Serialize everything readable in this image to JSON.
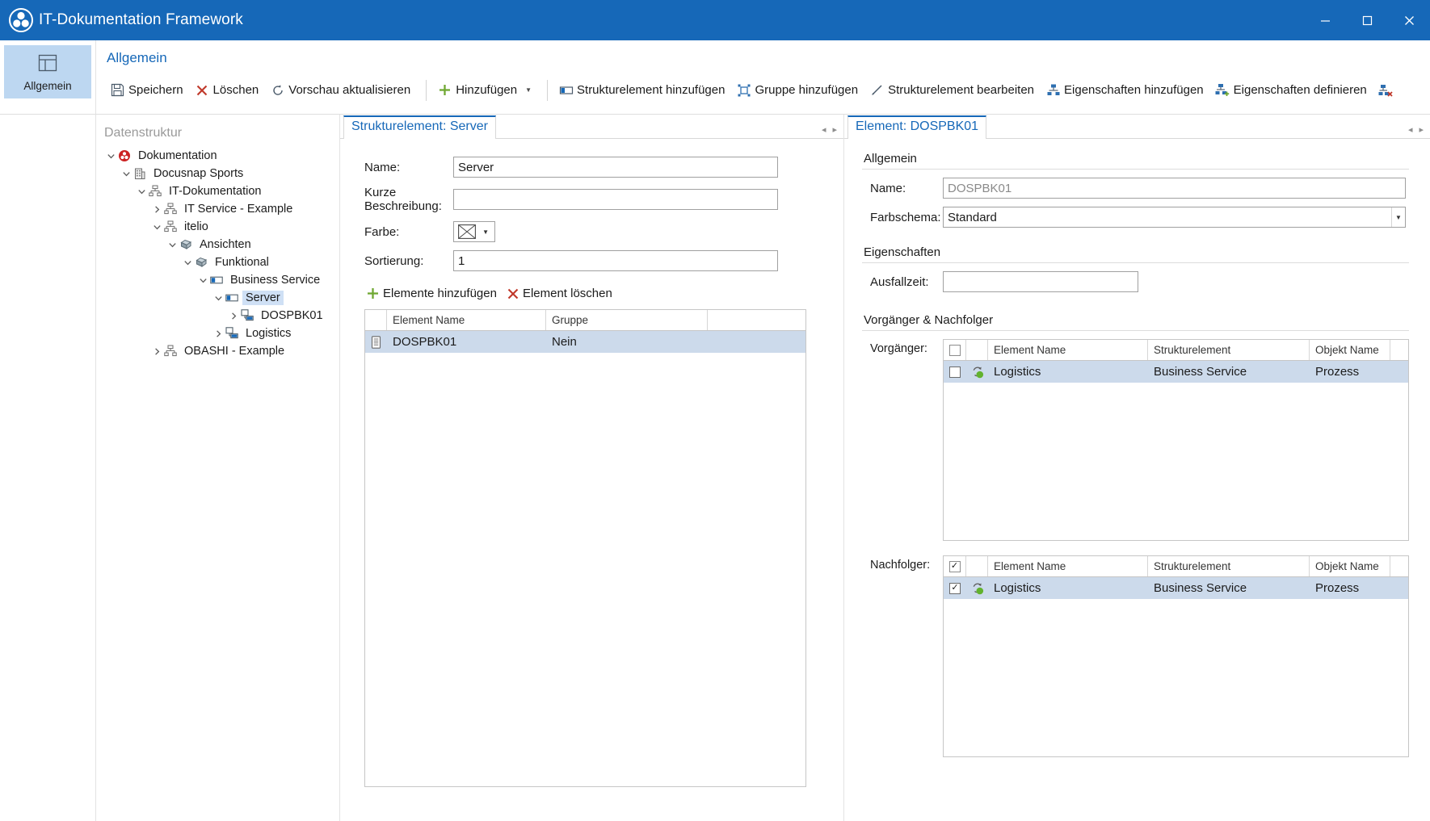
{
  "window": {
    "title": "IT-Dokumentation Framework",
    "logo_icon": "docusnap-logo-icon",
    "minimize_icon": "minimize-icon",
    "maximize_icon": "maximize-icon",
    "close_icon": "close-icon",
    "accent_color": "#1668b8"
  },
  "ribbon": {
    "tab": {
      "label": "Allgemein",
      "icon": "window-layout-icon"
    },
    "group_label": "Allgemein",
    "commands": [
      {
        "label": "Speichern",
        "icon": "save-icon"
      },
      {
        "label": "Löschen",
        "icon": "delete-x-icon"
      },
      {
        "label": "Vorschau aktualisieren",
        "icon": "refresh-icon"
      },
      {
        "label": "Hinzufügen",
        "icon": "add-plus-icon",
        "dropdown": "▼"
      },
      {
        "label": "Strukturelement hinzufügen",
        "icon": "structure-element-icon"
      },
      {
        "label": "Gruppe hinzufügen",
        "icon": "group-icon"
      },
      {
        "label": "Strukturelement bearbeiten",
        "icon": "edit-pencil-icon"
      },
      {
        "label": "Eigenschaften hinzufügen",
        "icon": "properties-add-icon"
      },
      {
        "label": "Eigenschaften definieren",
        "icon": "properties-define-icon"
      },
      {
        "label": "",
        "icon": "properties-delete-icon"
      }
    ]
  },
  "tree": {
    "caption": "Datenstruktur",
    "nodes": [
      {
        "label": "Dokumentation",
        "depth": 0,
        "expander": "expanded",
        "icon": "documentation-icon"
      },
      {
        "label": "Docusnap Sports",
        "depth": 1,
        "expander": "expanded",
        "icon": "company-icon"
      },
      {
        "label": "IT-Dokumentation",
        "depth": 2,
        "expander": "expanded",
        "icon": "structure-tree-icon"
      },
      {
        "label": "IT Service - Example",
        "depth": 3,
        "expander": "collapsed",
        "icon": "structure-tree-icon"
      },
      {
        "label": "itelio",
        "depth": 3,
        "expander": "expanded",
        "icon": "structure-tree-icon"
      },
      {
        "label": "Ansichten",
        "depth": 4,
        "expander": "expanded",
        "icon": "views-icon"
      },
      {
        "label": "Funktional",
        "depth": 5,
        "expander": "expanded",
        "icon": "views-icon"
      },
      {
        "label": "Business Service",
        "depth": 6,
        "expander": "expanded",
        "icon": "structure-element-icon"
      },
      {
        "label": "Server",
        "depth": 7,
        "expander": "expanded",
        "icon": "structure-element-icon",
        "selected": true
      },
      {
        "label": "DOSPBK01",
        "depth": 8,
        "expander": "collapsed",
        "icon": "element-node-icon"
      },
      {
        "label": "Logistics",
        "depth": 7,
        "expander": "collapsed",
        "icon": "element-node-icon"
      },
      {
        "label": "OBASHI - Example",
        "depth": 3,
        "expander": "collapsed",
        "icon": "structure-tree-icon"
      }
    ]
  },
  "center_panel": {
    "tab_label": "Strukturelement: Server",
    "nav_prev_icon": "nav-prev-icon",
    "nav_next_icon": "nav-next-icon",
    "fields": {
      "name_label": "Name:",
      "name_value": "Server",
      "description_label": "Kurze Beschreibung:",
      "description_value": "",
      "description_placeholder": "",
      "color_label": "Farbe:",
      "color_value": "none",
      "color_icon": "no-color-icon",
      "sort_label": "Sortierung:",
      "sort_value": "1"
    },
    "commands": [
      {
        "label": "Elemente hinzufügen",
        "icon": "add-plus-icon"
      },
      {
        "label": "Element löschen",
        "icon": "delete-x-icon"
      }
    ],
    "grid": {
      "columns": [
        "",
        "Element Name",
        "Gruppe",
        ""
      ],
      "rows": [
        {
          "icon": "server-icon",
          "element_name": "DOSPBK01",
          "gruppe": "Nein",
          "selected": true
        }
      ]
    }
  },
  "right_panel": {
    "tab_label": "Element: DOSPBK01",
    "nav_prev_icon": "nav-prev-icon",
    "nav_next_icon": "nav-next-icon",
    "sections": {
      "general": "Allgemein",
      "properties": "Eigenschaften",
      "relations": "Vorgänger & Nachfolger"
    },
    "fields": {
      "name_label": "Name:",
      "name_value": "DOSPBK01",
      "colorscheme_label": "Farbschema:",
      "colorscheme_value": "Standard",
      "downtime_label": "Ausfallzeit:",
      "downtime_value": ""
    },
    "predecessors": {
      "label": "Vorgänger:",
      "header_checked": false,
      "columns": [
        "",
        "",
        "Element Name",
        "Strukturelement",
        "Objekt Name",
        ""
      ],
      "rows": [
        {
          "checked": false,
          "icon": "process-icon",
          "element_name": "Logistics",
          "strukturelement": "Business Service",
          "objekt_name": "Prozess",
          "selected": true
        }
      ]
    },
    "successors": {
      "label": "Nachfolger:",
      "header_checked": true,
      "columns": [
        "",
        "",
        "Element Name",
        "Strukturelement",
        "Objekt Name",
        ""
      ],
      "rows": [
        {
          "checked": true,
          "icon": "process-icon",
          "element_name": "Logistics",
          "strukturelement": "Business Service",
          "objekt_name": "Prozess",
          "selected": true
        }
      ]
    }
  }
}
